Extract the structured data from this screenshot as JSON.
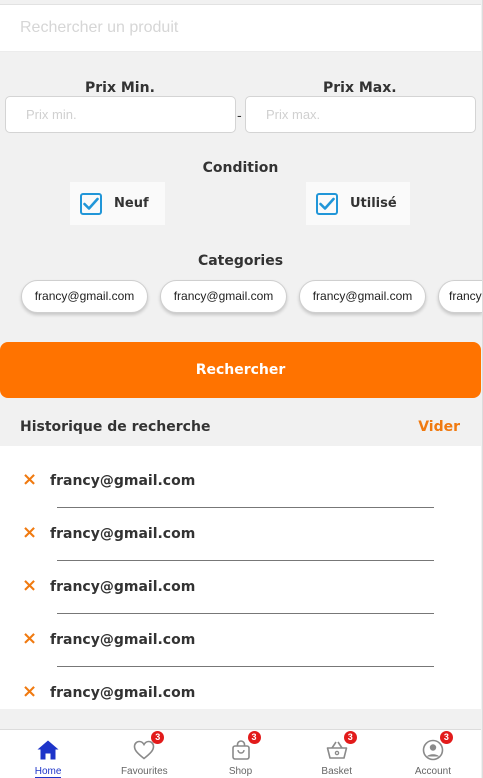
{
  "search": {
    "placeholder": "Rechercher un produit"
  },
  "price": {
    "min_label": "Prix Min.",
    "max_label": "Prix Max.",
    "min_placeholder": "Prix min.",
    "max_placeholder": "Prix max.",
    "separator": "-"
  },
  "condition": {
    "title": "Condition",
    "options": [
      {
        "label": "Neuf",
        "checked": true
      },
      {
        "label": "Utilisé",
        "checked": true
      }
    ]
  },
  "categories": {
    "title": "Categories",
    "chips": [
      "francy@gmail.com",
      "francy@gmail.com",
      "francy@gmail.com",
      "francy@gmail.com"
    ]
  },
  "search_button": {
    "label": "Rechercher"
  },
  "history": {
    "title": "Historique de recherche",
    "clear_label": "Vider",
    "remove_icon": "×",
    "items": [
      "francy@gmail.com",
      "francy@gmail.com",
      "francy@gmail.com",
      "francy@gmail.com",
      "francy@gmail.com"
    ]
  },
  "bottom_nav": {
    "items": [
      {
        "label": "Home",
        "icon": "home-icon",
        "badge": "",
        "active": true
      },
      {
        "label": "Favourites",
        "icon": "heart-icon",
        "badge": "3",
        "active": false
      },
      {
        "label": "Shop",
        "icon": "shopping-bag-icon",
        "badge": "3",
        "active": false
      },
      {
        "label": "Basket",
        "icon": "basket-icon",
        "badge": "3",
        "active": false
      },
      {
        "label": "Account",
        "icon": "account-icon",
        "badge": "3",
        "active": false
      }
    ]
  },
  "colors": {
    "accent": "#ff7300",
    "checkbox": "#2196d8",
    "nav_active": "#1d34c9",
    "badge": "#e21b1b"
  }
}
